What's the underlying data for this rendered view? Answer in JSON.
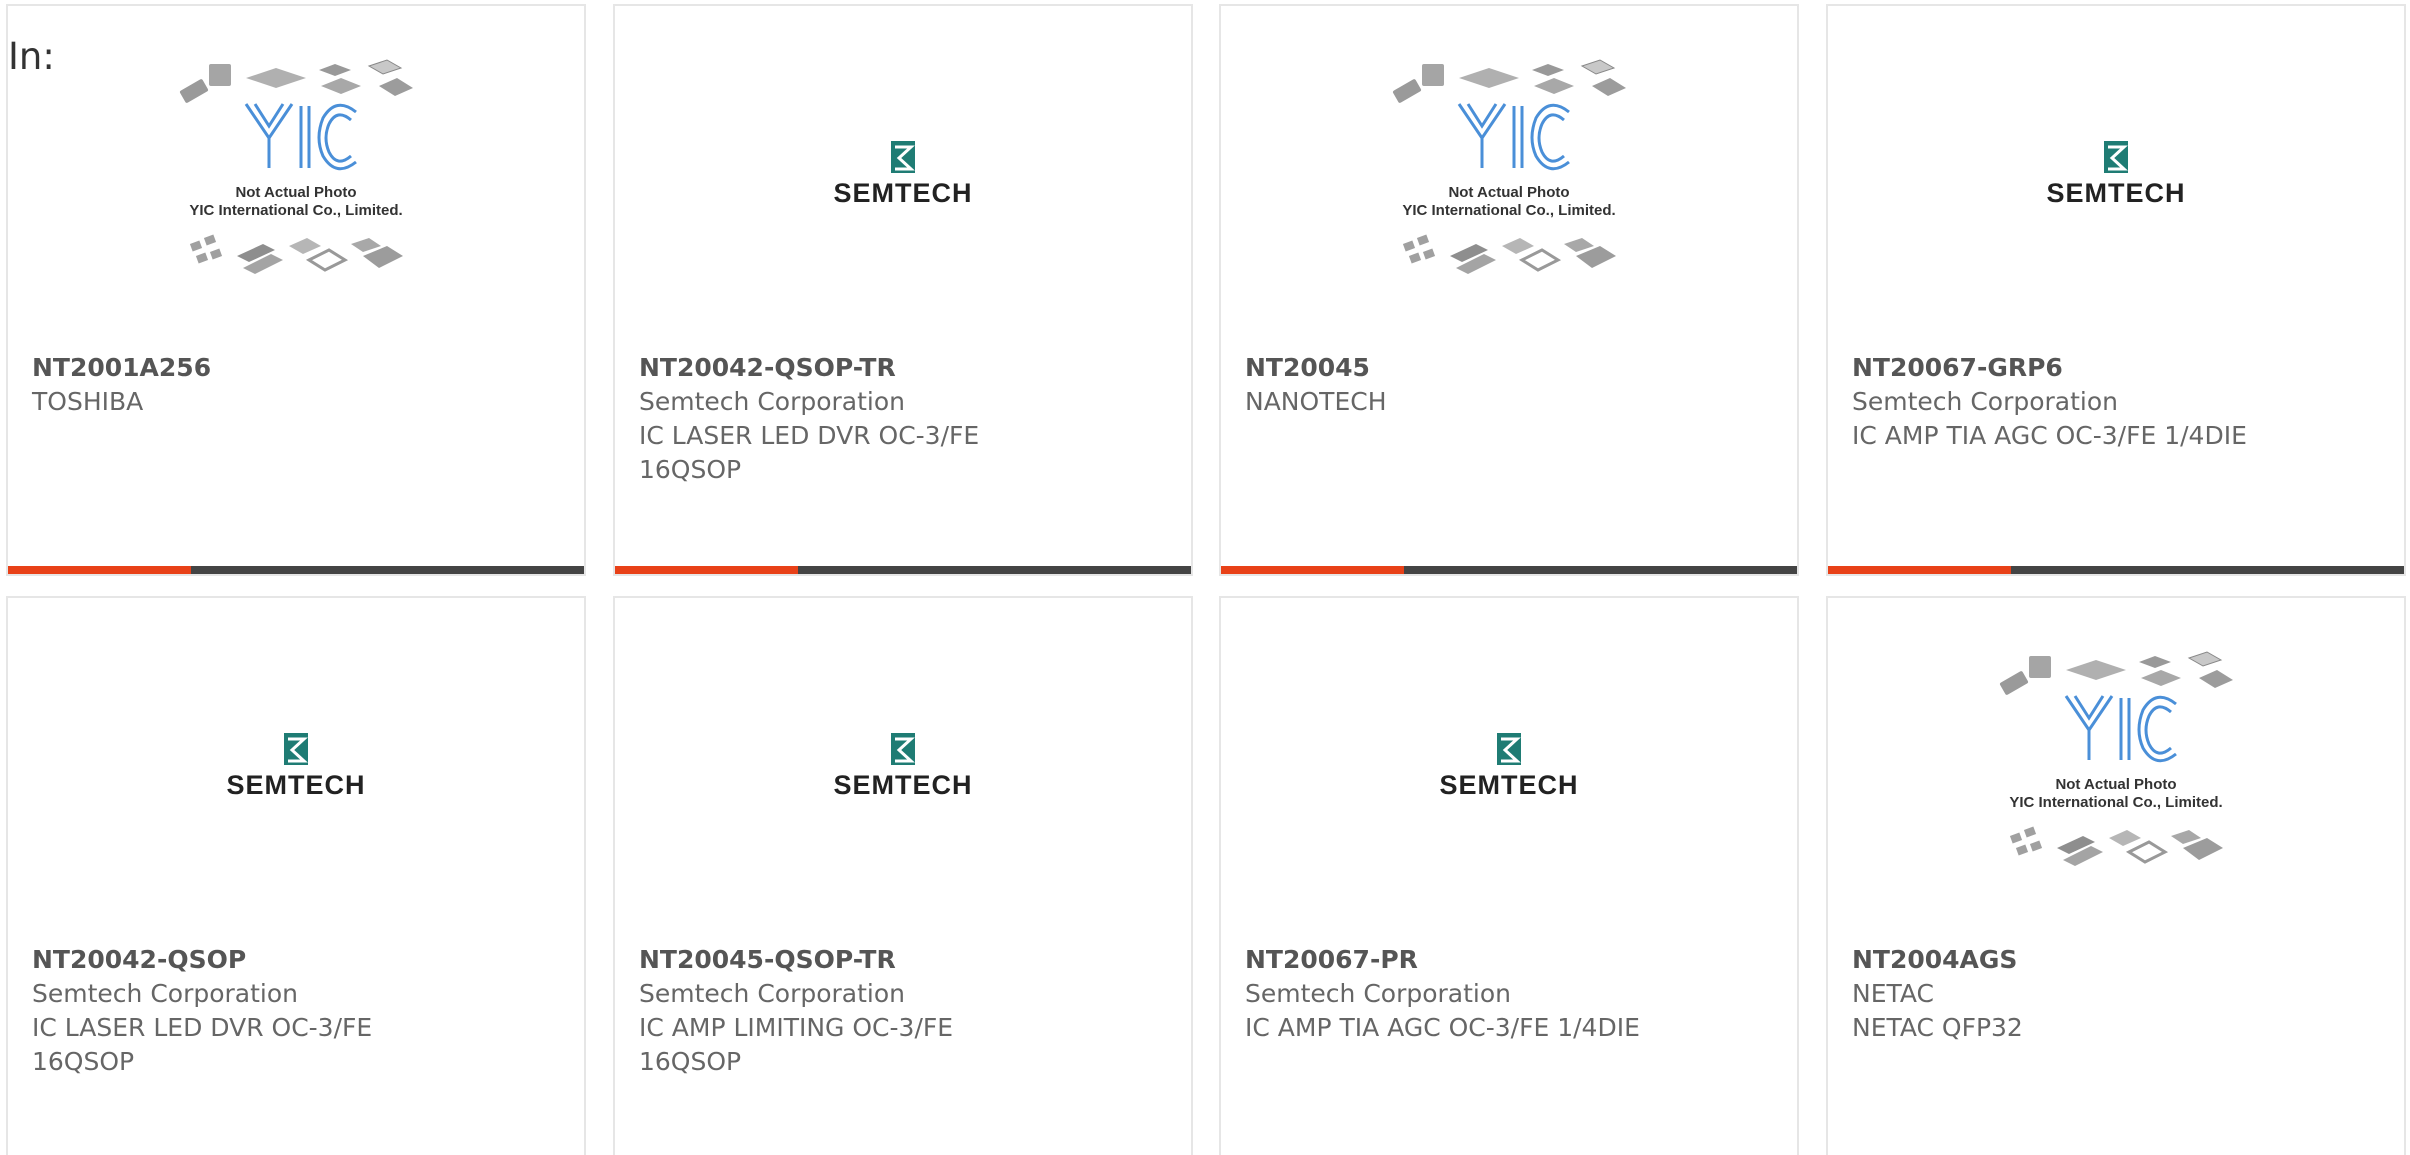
{
  "header": {
    "label": "In:"
  },
  "colors": {
    "accent": "#e84118",
    "bar": "#444444",
    "yic_blue": "#4a8fd8",
    "semtech_teal": "#1f7c74"
  },
  "placeholder": {
    "logo_text": "YIC",
    "line1": "Not Actual Photo",
    "line2": "YIC International Co., Limited."
  },
  "logos": {
    "semtech": "SEMTECH"
  },
  "products": [
    {
      "part": "NT2001A256",
      "manufacturer": "TOSHIBA",
      "desc1": "",
      "desc2": "",
      "image": "yic-placeholder"
    },
    {
      "part": "NT20042-QSOP-TR",
      "manufacturer": "Semtech Corporation",
      "desc1": "IC LASER LED DVR OC-3/FE",
      "desc2": "16QSOP",
      "image": "semtech-logo"
    },
    {
      "part": "NT20045",
      "manufacturer": "NANOTECH",
      "desc1": "",
      "desc2": "",
      "image": "yic-placeholder"
    },
    {
      "part": "NT20067-GRP6",
      "manufacturer": "Semtech Corporation",
      "desc1": "IC AMP TIA AGC OC-3/FE 1/4DIE",
      "desc2": "",
      "image": "semtech-logo"
    },
    {
      "part": "NT20042-QSOP",
      "manufacturer": "Semtech Corporation",
      "desc1": "IC LASER LED DVR OC-3/FE",
      "desc2": "16QSOP",
      "image": "semtech-logo"
    },
    {
      "part": "NT20045-QSOP-TR",
      "manufacturer": "Semtech Corporation",
      "desc1": "IC AMP LIMITING OC-3/FE",
      "desc2": "16QSOP",
      "image": "semtech-logo"
    },
    {
      "part": "NT20067-PR",
      "manufacturer": "Semtech Corporation",
      "desc1": "IC AMP TIA AGC OC-3/FE 1/4DIE",
      "desc2": "",
      "image": "semtech-logo"
    },
    {
      "part": "NT2004AGS",
      "manufacturer": "NETAC",
      "desc1": "NETAC QFP32",
      "desc2": "",
      "image": "yic-placeholder"
    }
  ]
}
